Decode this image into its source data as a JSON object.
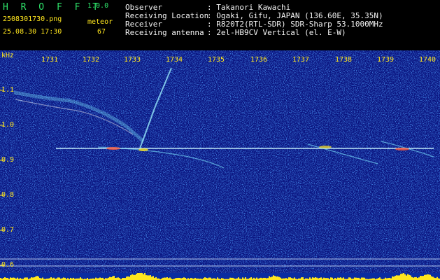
{
  "header": {
    "app_name": "H R O F F T",
    "version": "1.0.0",
    "filename": "2508301730.png",
    "timestamp": "25.08.30 17:30",
    "meteor_label": "meteor",
    "meteor_count": "67",
    "info_labels": [
      "Observer",
      "Receiving Location",
      "Receiver",
      "Receiving antenna"
    ],
    "info_values": [
      ": Takanori Kawachi",
      ": Ogaki, Gifu, JAPAN (136.60E, 35.35N)",
      ": R820T2(RTL-SDR) SDR-Sharp 53.1000MHz",
      ": 2el-HB9CV Vertical (el. E-W)"
    ]
  },
  "plot": {
    "unit_label": "kHz",
    "x_ticks": [
      "1731",
      "1732",
      "1733",
      "1734",
      "1735",
      "1736",
      "1737",
      "1738",
      "1739",
      "1740"
    ],
    "y_ticks": [
      "1.1",
      "1.0",
      "0.9",
      "0.8",
      "0.7",
      "0.6"
    ]
  },
  "colors": {
    "background": "#0a1480",
    "header_green": "#2ee36a",
    "header_yellow": "#ffe61e",
    "signal_cyan": "#7fe8ff",
    "signal_hot": "#ff5a3c"
  }
}
